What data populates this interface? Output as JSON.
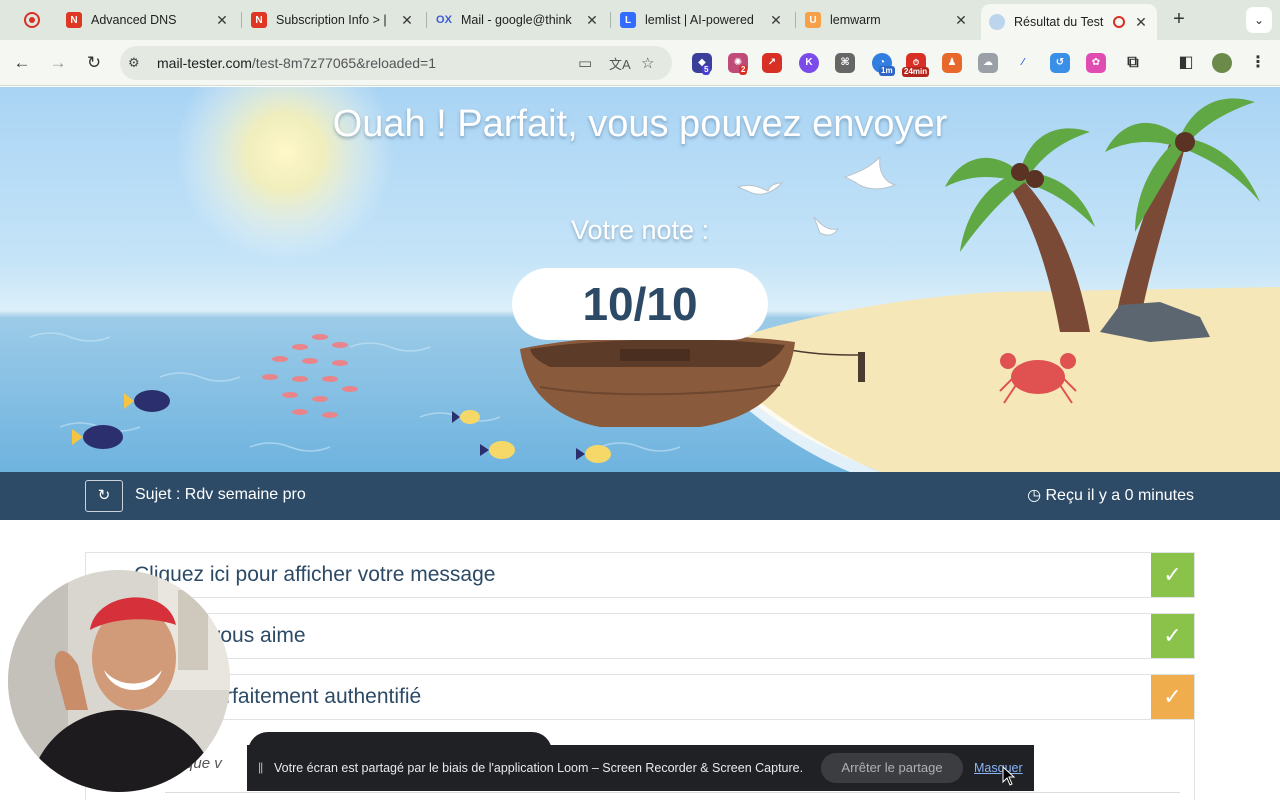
{
  "browser": {
    "tabs": [
      {
        "title": "Advanced DNS",
        "favicon": "namecheap-icon",
        "color": "#de3723"
      },
      {
        "title": "Subscription Info > |",
        "favicon": "namecheap-icon",
        "color": "#de3723"
      },
      {
        "title": "Mail - google@think",
        "favicon": "ox-mail-icon",
        "color": "#3b5bd9"
      },
      {
        "title": "lemlist | AI-powered",
        "favicon": "lemlist-icon",
        "color": "#316bff"
      },
      {
        "title": "lemwarm",
        "favicon": "lemwarm-icon",
        "color": "#f6a14a"
      },
      {
        "title": "Résultat du Test",
        "favicon": "mail-tester-icon",
        "color": "#bcd4ec"
      }
    ],
    "url_host": "mail-tester.com",
    "url_path": "/test-8m7z77065&reloaded=1",
    "extension_badges": [
      "5",
      "2",
      "1m",
      "24min"
    ]
  },
  "hero": {
    "title": "Ouah ! Parfait, vous pouvez envoyer",
    "score_label": "Votre note :",
    "score": "10/10"
  },
  "subject_bar": {
    "subject": "Sujet : Rdv semaine pro",
    "received": "Reçu il y a 0 minutes"
  },
  "checks": [
    {
      "label": "Cliquez ici pour afficher votre message",
      "status": "pass",
      "color": "#8bc34a"
    },
    {
      "label": "ssassin vous aime",
      "status": "pass",
      "color": "#8bc34a"
    },
    {
      "label": "es pas parfaitement authentifié",
      "status": "warning",
      "color": "#f0ad4e"
    }
  ],
  "partial_text": "ns que v",
  "loom": {
    "message": "Votre écran est partagé par le biais de l'application Loom – Screen Recorder & Screen Capture.",
    "stop_label": "Arrêter le partage",
    "hide_label": "Masquer"
  }
}
